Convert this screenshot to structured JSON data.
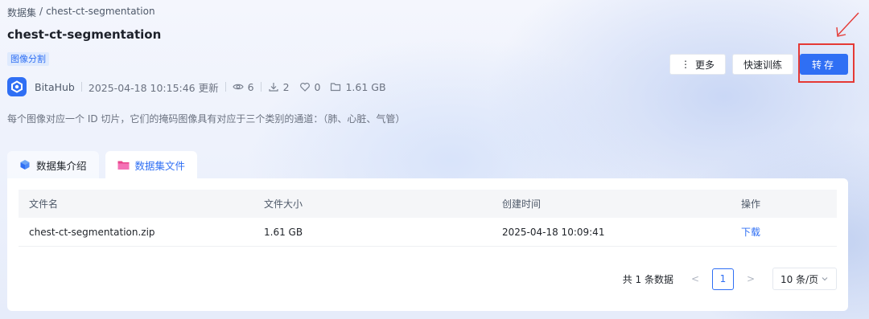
{
  "breadcrumb": {
    "root": "数据集",
    "separator": "/",
    "current": "chest-ct-segmentation"
  },
  "title": "chest-ct-segmentation",
  "tag": "图像分割",
  "meta": {
    "owner": "BitaHub",
    "updated": "2025-04-18 10:15:46 更新",
    "views": "6",
    "downloads": "2",
    "likes": "0",
    "size": "1.61 GB"
  },
  "description": "每个图像对应一个 ID 切片，它们的掩码图像具有对应于三个类别的通道：（肺、心脏、气管）",
  "actions": {
    "more": "更多",
    "quick_train": "快速训练",
    "transfer": "转存"
  },
  "tabs": [
    {
      "label": "数据集介绍",
      "icon": "cube-icon"
    },
    {
      "label": "数据集文件",
      "icon": "folder-icon"
    }
  ],
  "table": {
    "headers": [
      "文件名",
      "文件大小",
      "创建时间",
      "操作"
    ],
    "rows": [
      {
        "name": "chest-ct-segmentation.zip",
        "size": "1.61 GB",
        "created": "2025-04-18 10:09:41",
        "action": "下载"
      }
    ]
  },
  "pagination": {
    "total": "共 1 条数据",
    "prev": "<",
    "current": "1",
    "next": ">",
    "page_size": "10 条/页"
  },
  "colors": {
    "primary": "#2f6ff4",
    "highlight": "#e53935"
  }
}
